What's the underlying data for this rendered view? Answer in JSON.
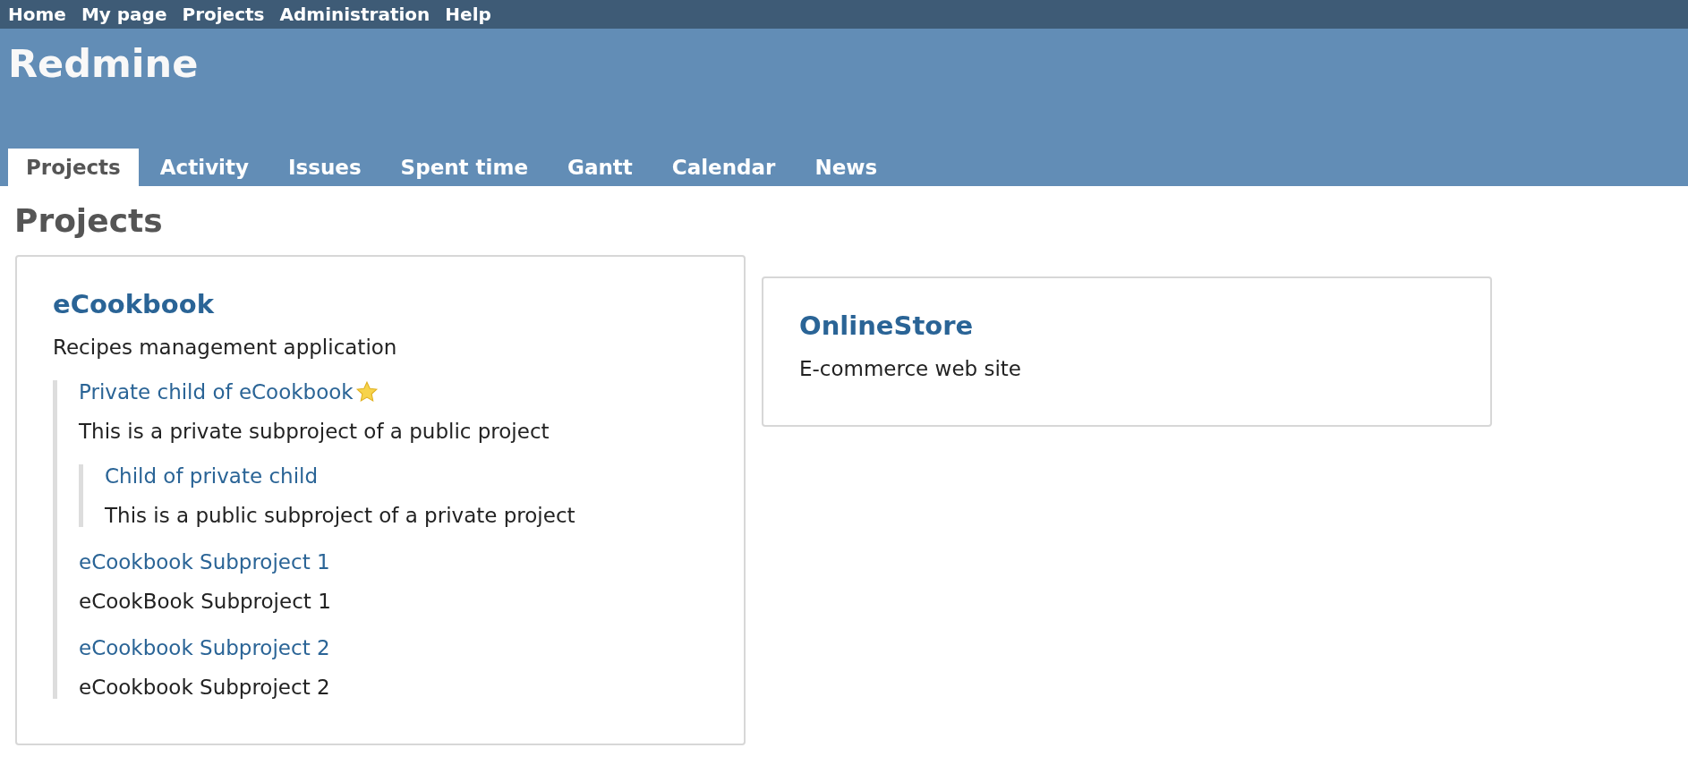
{
  "top_menu": [
    "Home",
    "My page",
    "Projects",
    "Administration",
    "Help"
  ],
  "header": {
    "title": "Redmine"
  },
  "tabs": [
    {
      "label": "Projects",
      "selected": true
    },
    {
      "label": "Activity",
      "selected": false
    },
    {
      "label": "Issues",
      "selected": false
    },
    {
      "label": "Spent time",
      "selected": false
    },
    {
      "label": "Gantt",
      "selected": false
    },
    {
      "label": "Calendar",
      "selected": false
    },
    {
      "label": "News",
      "selected": false
    }
  ],
  "page_title": "Projects",
  "projects": [
    {
      "name": "eCookbook",
      "description": "Recipes management application",
      "starred": false,
      "children": [
        {
          "name": "Private child of eCookbook",
          "description": "This is a private subproject of a public project",
          "starred": true,
          "children": [
            {
              "name": "Child of private child",
              "description": "This is a public subproject of a private project",
              "starred": false
            }
          ]
        },
        {
          "name": "eCookbook Subproject 1",
          "description": "eCookBook Subproject 1",
          "starred": false
        },
        {
          "name": "eCookbook Subproject 2",
          "description": "eCookbook Subproject 2",
          "starred": false
        }
      ]
    },
    {
      "name": "OnlineStore",
      "description": "E-commerce web site",
      "starred": false
    }
  ]
}
